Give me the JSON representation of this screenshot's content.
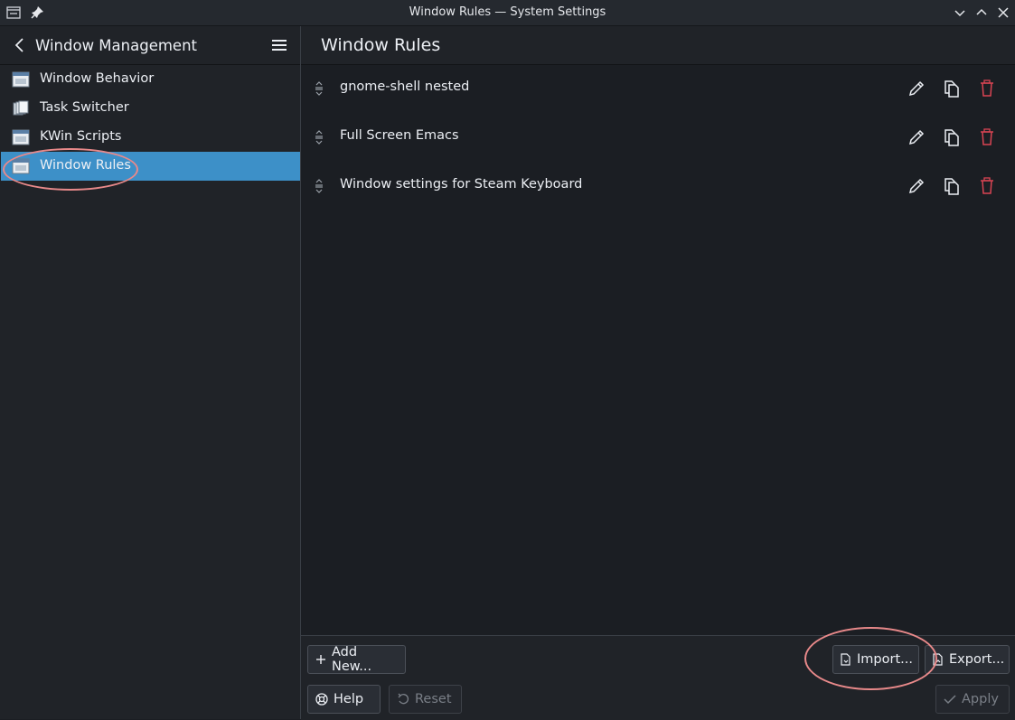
{
  "window": {
    "title": "Window Rules — System Settings"
  },
  "sidebar": {
    "header": "Window Management",
    "items": [
      {
        "label": "Window Behavior",
        "icon": "window-behavior-icon"
      },
      {
        "label": "Task Switcher",
        "icon": "task-switcher-icon"
      },
      {
        "label": "KWin Scripts",
        "icon": "kwin-scripts-icon"
      },
      {
        "label": "Window Rules",
        "icon": "window-rules-icon",
        "active": true
      }
    ]
  },
  "main": {
    "title": "Window Rules",
    "rules": [
      {
        "name": "gnome-shell nested"
      },
      {
        "name": "Full Screen Emacs"
      },
      {
        "name": "Window settings for Steam Keyboard"
      }
    ]
  },
  "footer": {
    "add_new": "Add New...",
    "import": "Import...",
    "export": "Export...",
    "help": "Help",
    "reset": "Reset",
    "apply": "Apply"
  },
  "colors": {
    "accent": "#3d90c8",
    "delete": "#da4453",
    "annotation": "#e8898a",
    "background": "#1b1e23"
  }
}
